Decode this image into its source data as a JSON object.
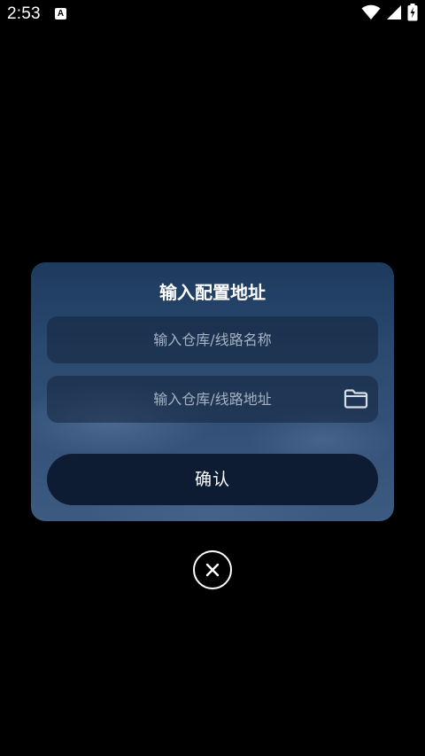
{
  "status_bar": {
    "time": "2:53",
    "notification_icon": "A",
    "icons": [
      "wifi-icon",
      "cellular-signal-icon",
      "battery-charging-icon"
    ]
  },
  "dialog": {
    "title": "输入配置地址",
    "name_field": {
      "placeholder": "输入仓库/线路名称",
      "value": ""
    },
    "address_field": {
      "placeholder": "输入仓库/线路地址",
      "value": "",
      "icon": "folder-icon"
    },
    "confirm_label": "确认"
  },
  "close_button": {
    "icon": "close-icon"
  },
  "colors": {
    "background": "#000000",
    "dialog_top": "#1d3a5e",
    "dialog_bottom": "#3d5a80",
    "field_background": "#12223a",
    "button_background": "#0e1c33",
    "placeholder_text": "#a6b2c2",
    "text": "#ffffff"
  }
}
